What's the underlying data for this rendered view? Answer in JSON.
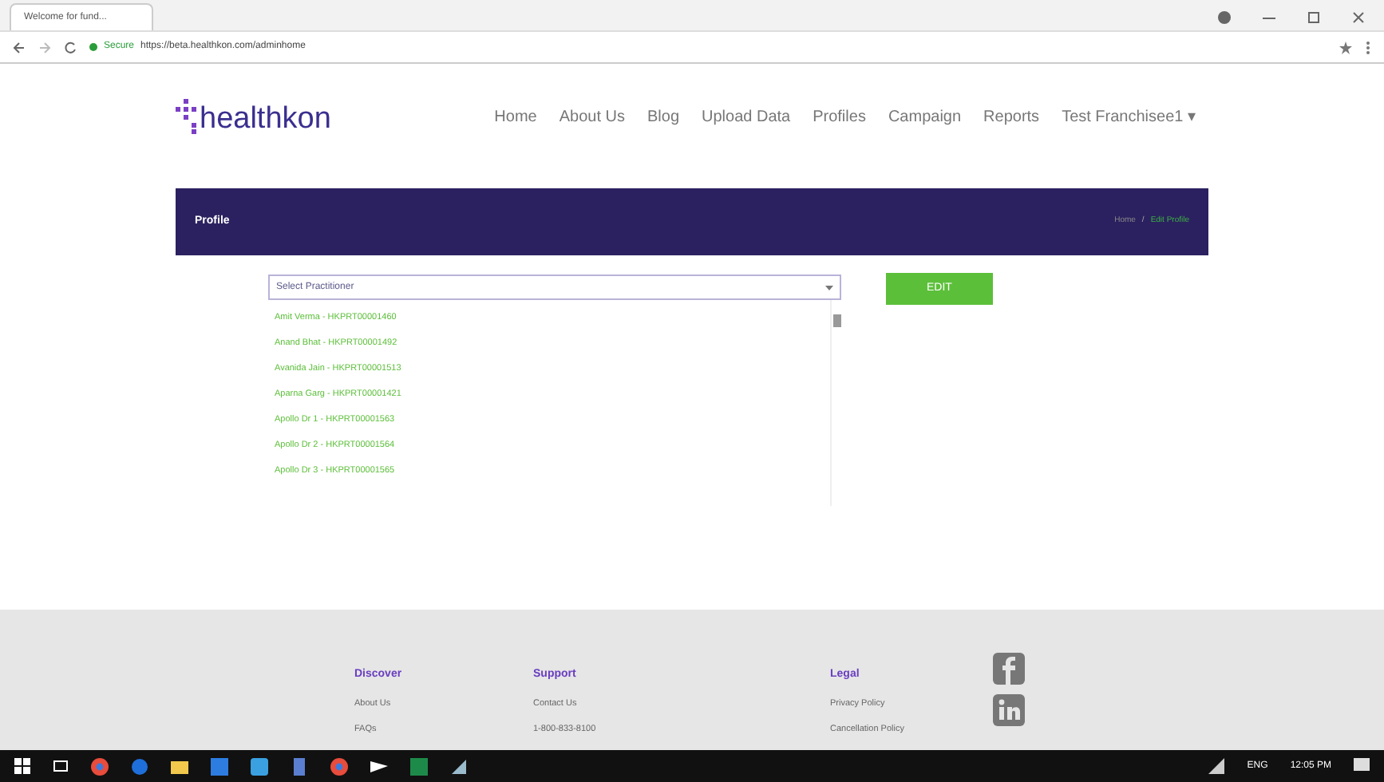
{
  "browser": {
    "tab_title": "Welcome for fund...",
    "url_secure": "Secure",
    "url": "https://beta.healthkon.com/adminhome"
  },
  "logo": {
    "text": "healthkon"
  },
  "nav": [
    {
      "label": "Home"
    },
    {
      "label": "About Us"
    },
    {
      "label": "Blog"
    },
    {
      "label": "Upload Data"
    },
    {
      "label": "Profiles"
    },
    {
      "label": "Campaign"
    },
    {
      "label": "Reports"
    },
    {
      "label": "Test Franchisee1 ▾"
    }
  ],
  "banner": {
    "title": "Profile",
    "breadcrumb_home": "Home",
    "breadcrumb_sep": "/",
    "breadcrumb_current": "Edit Profile"
  },
  "select": {
    "placeholder": "Select Practitioner",
    "expanded": true,
    "options": [
      {
        "label": "Amit Verma - HKPRT00001460"
      },
      {
        "label": "Anand Bhat - HKPRT00001492"
      },
      {
        "label": "Avanida Jain - HKPRT00001513"
      },
      {
        "label": "Aparna Garg - HKPRT00001421"
      },
      {
        "label": "Apollo Dr 1 - HKPRT00001563"
      },
      {
        "label": "Apollo Dr 2 - HKPRT00001564"
      },
      {
        "label": "Apollo Dr 3 - HKPRT00001565"
      }
    ]
  },
  "edit_button": "EDIT",
  "footer": {
    "columns": [
      {
        "heading": "Discover",
        "links": [
          "About Us",
          "FAQs"
        ]
      },
      {
        "heading": "Support",
        "links": [
          "Contact Us",
          "1-800-833-8100"
        ]
      },
      {
        "heading": "Legal",
        "links": [
          "Privacy Policy",
          "Cancellation Policy"
        ]
      }
    ]
  },
  "taskbar": {
    "lang": "ENG",
    "time": "12:05 PM"
  }
}
